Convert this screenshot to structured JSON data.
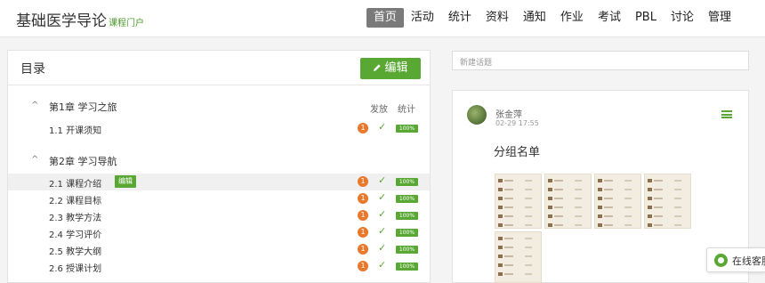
{
  "header": {
    "title": "基础医学导论",
    "subtitle": "课程门户",
    "nav": [
      "首页",
      "活动",
      "统计",
      "资料",
      "通知",
      "作业",
      "考试",
      "PBL",
      "讨论",
      "管理"
    ],
    "active_nav": "首页"
  },
  "catalog": {
    "title": "目录",
    "edit_label": "编辑",
    "col_publish": "发放",
    "col_stats": "统计",
    "chapters": [
      {
        "arrow": "^",
        "title": "第1章 学习之旅",
        "lessons": [
          {
            "label": "1.1 开课须知",
            "count": "1",
            "progress": "100%"
          }
        ]
      },
      {
        "arrow": "^",
        "title": "第2章 学习导航",
        "lessons": [
          {
            "label": "2.1 课程介绍",
            "count": "1",
            "progress": "100%",
            "edit_badge": "编辑"
          },
          {
            "label": "2.2 课程目标",
            "count": "1",
            "progress": "100%"
          },
          {
            "label": "2.3 教学方法",
            "count": "1",
            "progress": "100%"
          },
          {
            "label": "2.4 学习评价",
            "count": "1",
            "progress": "100%"
          },
          {
            "label": "2.5 教学大纲",
            "count": "1",
            "progress": "100%"
          },
          {
            "label": "2.6 授课计划",
            "count": "1",
            "progress": "100%"
          }
        ]
      }
    ]
  },
  "discussion": {
    "new_topic_placeholder": "新建话题",
    "post": {
      "author": "张金萍",
      "time": "02-29 17:55",
      "title": "分组名单"
    }
  },
  "online_service": {
    "label": "在线客服"
  },
  "colors": {
    "accent": "#5aa834",
    "badge": "#e8782c",
    "nav_active": "#7a7a7a"
  }
}
